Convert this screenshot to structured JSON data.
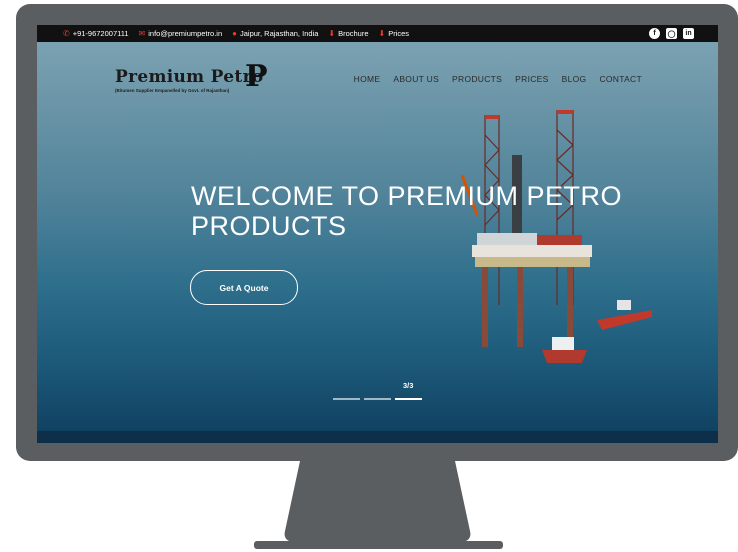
{
  "topbar": {
    "phone": "+91-9672007111",
    "email": "info@premiumpetro.in",
    "location": "Jaipur, Rajasthan, India",
    "brochure": "Brochure",
    "prices": "Prices",
    "social": [
      "facebook-icon",
      "instagram-icon",
      "linkedin-icon"
    ]
  },
  "logo": {
    "name": "Premium Petro",
    "tagline": "(Bitumen Supplier Empanelled by Govt. of Rajasthan)",
    "mark": "P"
  },
  "nav": {
    "items": [
      "HOME",
      "ABOUT US",
      "PRODUCTS",
      "PRICES",
      "BLOG",
      "CONTACT"
    ]
  },
  "hero": {
    "headline": "WELCOME TO PREMIUM PETRO PRODUCTS",
    "cta_label": "Get A Quote",
    "slide_counter": "3/3",
    "slide_count": 3,
    "active_slide": 3
  },
  "colors": {
    "accent": "#e53935",
    "topbar_bg": "#111111",
    "monitor": "#5b5e61"
  }
}
